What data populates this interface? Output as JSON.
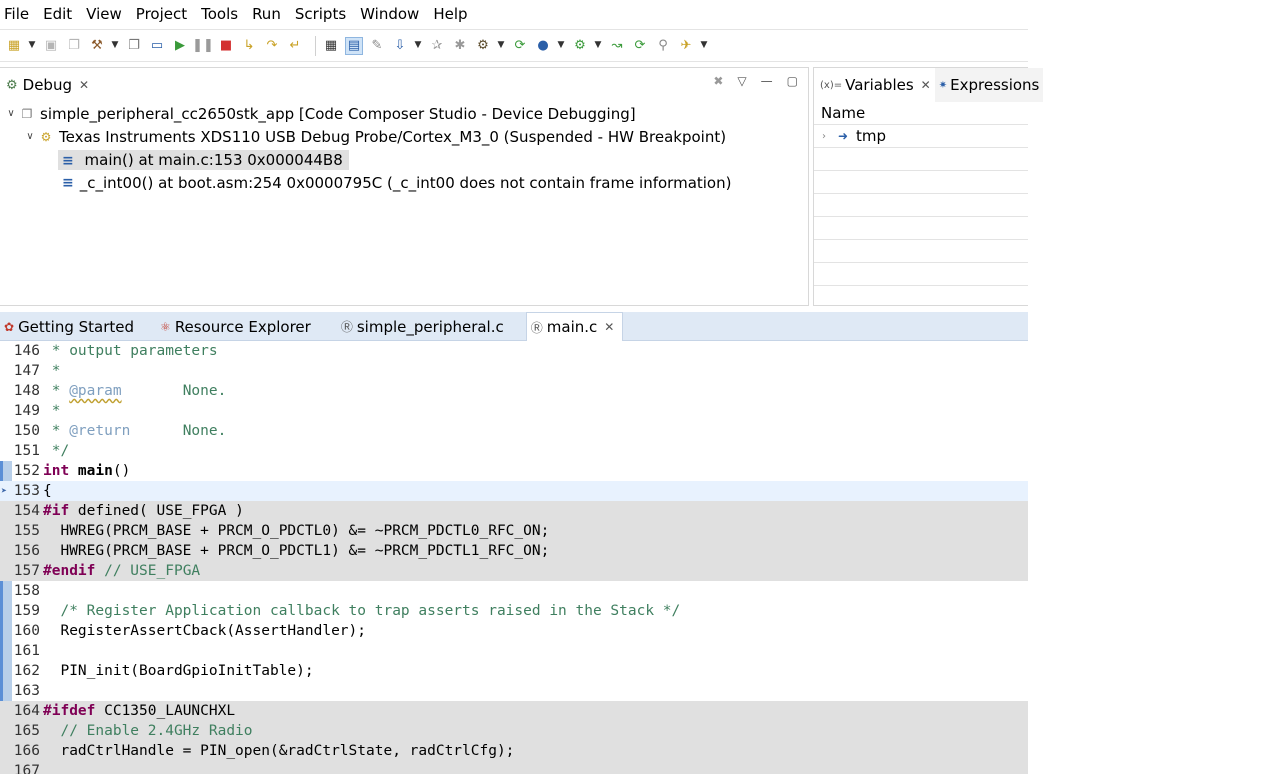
{
  "menu": [
    "File",
    "Edit",
    "View",
    "Project",
    "Tools",
    "Run",
    "Scripts",
    "Window",
    "Help"
  ],
  "toolbar_icons": [
    "new-icon",
    "save-icon",
    "save-all-icon",
    "build-icon",
    "console-icon",
    "terminal-icon",
    "resume-icon",
    "suspend-icon",
    "terminate-icon",
    "step-into-icon",
    "step-over-icon",
    "step-return-icon",
    "memory-browser-icon",
    "registers-icon",
    "breakpoint-icon",
    "load-program-icon",
    "disconnect-icon",
    "reset-icon",
    "restart-icon",
    "target-icon",
    "debug-icon",
    "run-icon",
    "search-icon",
    "tools-icon"
  ],
  "debug_view": {
    "tab_label": "Debug",
    "tree": {
      "project": "simple_peripheral_cc2650stk_app [Code Composer Studio - Device Debugging]",
      "thread": "Texas Instruments XDS110 USB Debug Probe/Cortex_M3_0 (Suspended - HW Breakpoint)",
      "frames": [
        "main() at main.c:153 0x000044B8",
        "_c_int00() at boot.asm:254 0x0000795C  (_c_int00 does not contain frame information)"
      ]
    }
  },
  "variables_view": {
    "tabs": [
      "Variables",
      "Expressions"
    ],
    "column_header": "Name",
    "rows": [
      "tmp"
    ]
  },
  "editor_tabs": [
    "Getting Started",
    "Resource Explorer",
    "simple_peripheral.c",
    "main.c"
  ],
  "code": {
    "line_numbers": [
      "146",
      "147",
      "148",
      "149",
      "150",
      "151",
      "152",
      "153",
      "154",
      "155",
      "156",
      "157",
      "158",
      "159",
      "160",
      "161",
      "162",
      "163",
      "164",
      "165",
      "166",
      "167"
    ],
    "l146": " * output parameters",
    "l147": " *",
    "l148_a": " * ",
    "l148_tag": "@param",
    "l148_b": "       None.",
    "l149": " *",
    "l150_a": " * ",
    "l150_tag": "@return",
    "l150_b": "      None.",
    "l151": " */",
    "l152_kw": "int",
    "l152_name": " main",
    "l152_rest": "()",
    "l153": "{",
    "l154_pp": "#if",
    "l154_rest": " defined( USE_FPGA )",
    "l155": "  HWREG(PRCM_BASE + PRCM_O_PDCTL0) &= ~PRCM_PDCTL0_RFC_ON;",
    "l156": "  HWREG(PRCM_BASE + PRCM_O_PDCTL1) &= ~PRCM_PDCTL1_RFC_ON;",
    "l157_pp": "#endif",
    "l157_cm": " // USE_FPGA",
    "l158": "",
    "l159": "  /* Register Application callback to trap asserts raised in the Stack */",
    "l160": "  RegisterAssertCback(AssertHandler);",
    "l161": "",
    "l162": "  PIN_init(BoardGpioInitTable);",
    "l163": "",
    "l164_pp": "#ifdef",
    "l164_rest": " CC1350_LAUNCHXL",
    "l165": "  // Enable 2.4GHz Radio",
    "l166": "  radCtrlHandle = PIN_open(&radCtrlState, radCtrlCfg);",
    "l167": ""
  }
}
